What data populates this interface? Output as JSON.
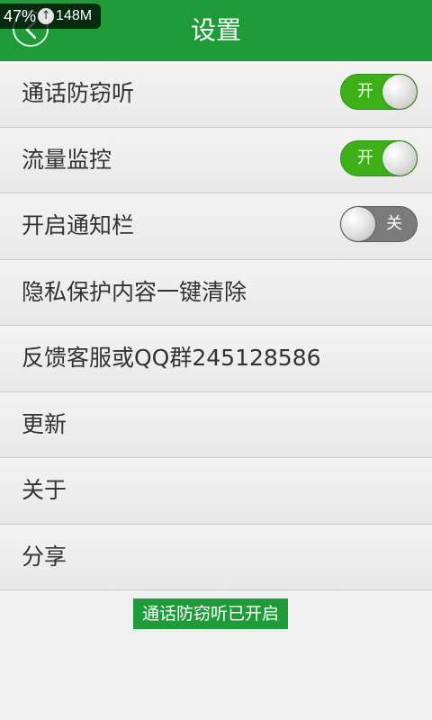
{
  "overlay": {
    "percent": "47%",
    "up_icon": "↑",
    "memory": "148M"
  },
  "header": {
    "title": "设置"
  },
  "settings": {
    "items": [
      {
        "label": "通话防窃听",
        "toggle": "开"
      },
      {
        "label": "流量监控",
        "toggle": "开"
      },
      {
        "label": "开启通知栏",
        "toggle": "关"
      },
      {
        "label": "隐私保护内容一键清除"
      },
      {
        "label": "反馈客服或QQ群245128586"
      },
      {
        "label": "更新"
      },
      {
        "label": "关于"
      },
      {
        "label": "分享"
      }
    ]
  },
  "toast": {
    "text": "通话防窃听已开启"
  },
  "colors": {
    "brand_green": "#1f9b3a",
    "toggle_on": "#3db019",
    "toggle_off": "#7b7b7b"
  }
}
